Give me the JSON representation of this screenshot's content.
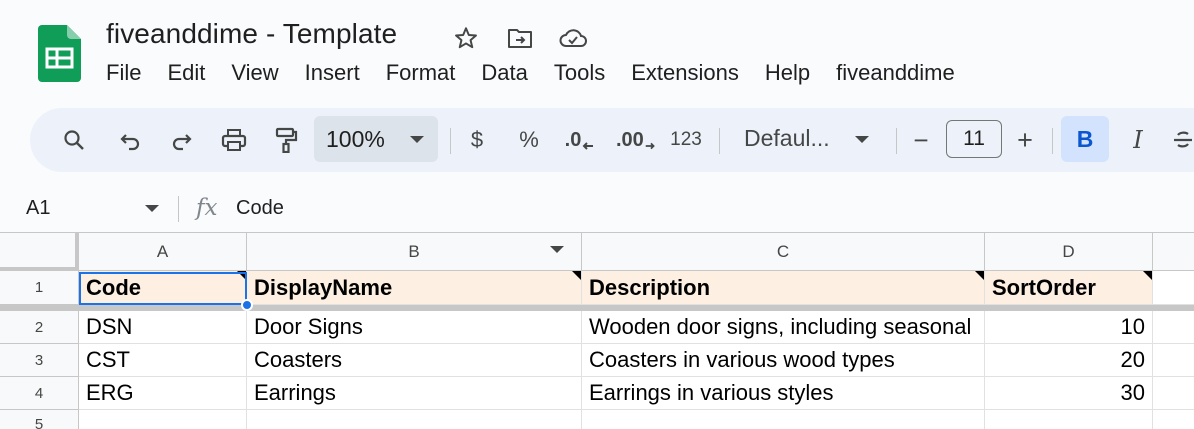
{
  "document": {
    "title": "fiveanddime - Template"
  },
  "menu": [
    "File",
    "Edit",
    "View",
    "Insert",
    "Format",
    "Data",
    "Tools",
    "Extensions",
    "Help",
    "fiveanddime"
  ],
  "toolbar": {
    "zoom": "100%",
    "currency": "$",
    "percent": "%",
    "decrease_decimal": ".0",
    "increase_decimal": ".00",
    "number_format": "123",
    "font": "Defaul...",
    "font_size": "11",
    "minus": "−",
    "plus": "+",
    "bold": "B",
    "italic": "I"
  },
  "formula_bar": {
    "cell_ref": "A1",
    "fx": "fx",
    "value": "Code"
  },
  "sheet": {
    "columns": [
      "A",
      "B",
      "C",
      "D"
    ],
    "rows": [
      {
        "num": "1",
        "cells": [
          "Code",
          "DisplayName",
          "Description",
          "SortOrder"
        ]
      },
      {
        "num": "2",
        "cells": [
          "DSN",
          "Door Signs",
          "Wooden door signs, including seasonal",
          "10"
        ]
      },
      {
        "num": "3",
        "cells": [
          "CST",
          "Coasters",
          "Coasters in various wood types",
          "20"
        ]
      },
      {
        "num": "4",
        "cells": [
          "ERG",
          "Earrings",
          "Earrings in various styles",
          "30"
        ]
      },
      {
        "num": "5",
        "cells": [
          "",
          "",
          "",
          ""
        ]
      }
    ]
  },
  "colors": {
    "header_fill": "#fdf0e2",
    "selection": "#1a73e8",
    "logo_green": "#0f9d58"
  }
}
